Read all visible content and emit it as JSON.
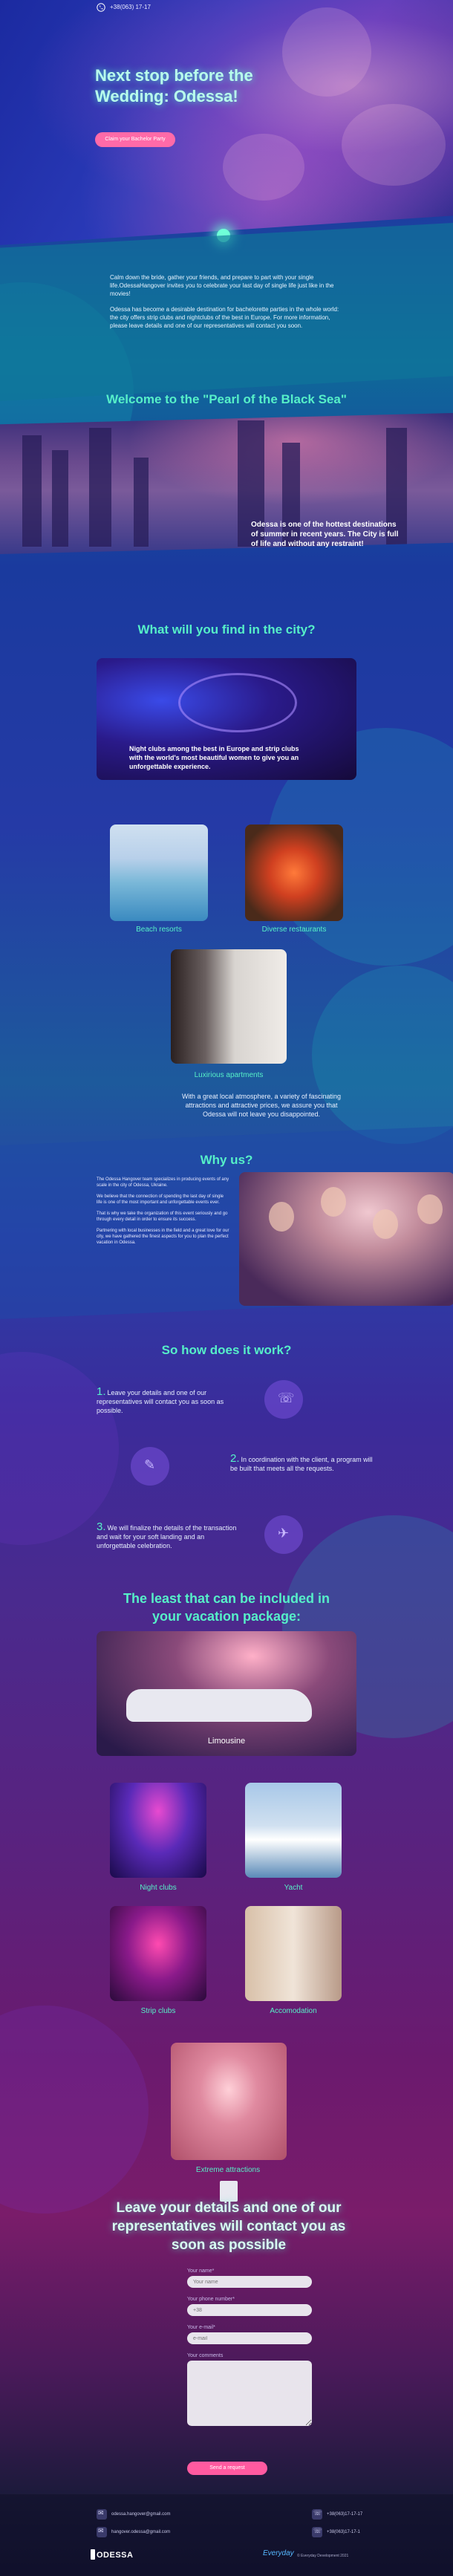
{
  "header": {
    "phone": "+38(063) 17-17"
  },
  "hero": {
    "title": "Next stop before the Wedding: Odessa!",
    "button": "Claim your Bachelor Party"
  },
  "intro": {
    "p1": "Calm down the bride, gather your friends, and prepare to part with your single life.OdessaHangover invites you to celebrate your last day of single life just like in the movies!",
    "p2": "Odessa has become a desirable destination for bachelorette parties in the whole world: the city offers strip clubs and nightclubs of the best in Europe. For more information, please leave details and one of our representatives will contact you soon."
  },
  "pearl": {
    "title": "Welcome to the \"Pearl of the Black Sea\"",
    "text": "Odessa is one of the hottest destinations of summer in recent years. The City is full of life and without any restraint!"
  },
  "find": {
    "title": "What will you find in the city?",
    "club_text": "Night clubs among the best in Europe and strip clubs with the world's most beautiful women to give you an unforgettable experience.",
    "cards": [
      "Beach resorts",
      "Diverse restaurants",
      "Luxirious apartments"
    ],
    "atmosphere": "With a great local atmosphere, a variety of fascinating attractions and attractive prices, we assure you that Odessa will not leave you disappointed."
  },
  "why": {
    "title": "Why us?",
    "p1": "The Odessa Hangover team specializes in producing events of any scale in the city of Odessa, Ukraine.",
    "p2": "We believe that the connection of spending the last day of single life is one of the most important and unforgettable events ever.",
    "p3": "That is why we take the organization of this event seriously and go through every detail in order to ensure its success.",
    "p4": "Partnering with local businesses in the field and a great love for our city, we have gathered the finest aspects for you to plan the perfect vacation in Odessa."
  },
  "how": {
    "title": "So how does it work?",
    "steps": [
      {
        "num": "1.",
        "text": "Leave your details and one of our representatives will contact you as soon as possible."
      },
      {
        "num": "2.",
        "text": "In coordination with the client, a program will be built that meets all the requests."
      },
      {
        "num": "3.",
        "text": "We will finalize the details of the transaction and wait for your soft landing and an unforgettable celebration."
      }
    ]
  },
  "package": {
    "title": "The least that can be included in your vacation package:",
    "limo": "Limousine",
    "items": [
      "Night clubs",
      "Yacht",
      "Strip clubs",
      "Accomodation",
      "Extreme attractions"
    ]
  },
  "form": {
    "title": "Leave your details and one of our representatives will contact you as soon as possible",
    "labels": [
      "Your name*",
      "Your phone number*",
      "Your e-mail*",
      "Your comments"
    ],
    "placeholders": [
      "Your name",
      "+38",
      "e-mail",
      ""
    ],
    "button": "Send a request"
  },
  "footer": {
    "email1": "odessa.hangover@gmail.com",
    "email2": "hangover.odessa@gmail.com",
    "phone1": "+38(063)17-17-17",
    "phone2": "+38(063)17-17-1",
    "logo": "ODESSA",
    "dev_logo": "Everyday",
    "dev_text": "© Everyday Development 2021"
  }
}
